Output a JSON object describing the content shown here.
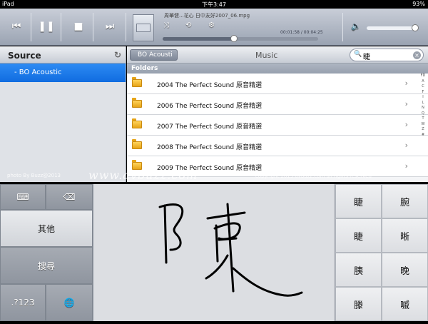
{
  "status": {
    "device": "iPad",
    "time": "下午3:47",
    "battery": "93%"
  },
  "player": {
    "track_title": "周華健...花心 日中友好2007_06.mpg",
    "elapsed": "00:01:58",
    "total": "00:04:25",
    "progress": 0.46,
    "volume": 0.95
  },
  "sidebar": {
    "title": "Source",
    "items": [
      {
        "label": "- BO Acoustic"
      }
    ]
  },
  "navbar": {
    "back_label": "BO Acousti",
    "title": "Music",
    "search_value": "睫"
  },
  "section_title": "Folders",
  "folders": [
    "2004 The Perfect Sound 原音精選",
    "2006 The Perfect Sound 原音精選",
    "2007 The Perfect Sound 原音精選",
    "2008 The Perfect Sound 原音精選",
    "2009 The Perfect Sound 原音精選"
  ],
  "index_letters": [
    "FD",
    "A",
    "C",
    "F",
    "I",
    "L",
    "N",
    "Q",
    "T",
    "W",
    "Z",
    "#"
  ],
  "watermark": {
    "left": "photo By Buzz@2013",
    "center": "www.avbuzz.com",
    "right": "copyright 2013 avbuzz.com all rights reserved"
  },
  "keyboard": {
    "other": "其他",
    "search": "搜尋",
    "numbers": ".?123"
  },
  "candidates": [
    "睫",
    "腕",
    "睫",
    "晰",
    "胰",
    "晚",
    "滕",
    "嘁"
  ]
}
